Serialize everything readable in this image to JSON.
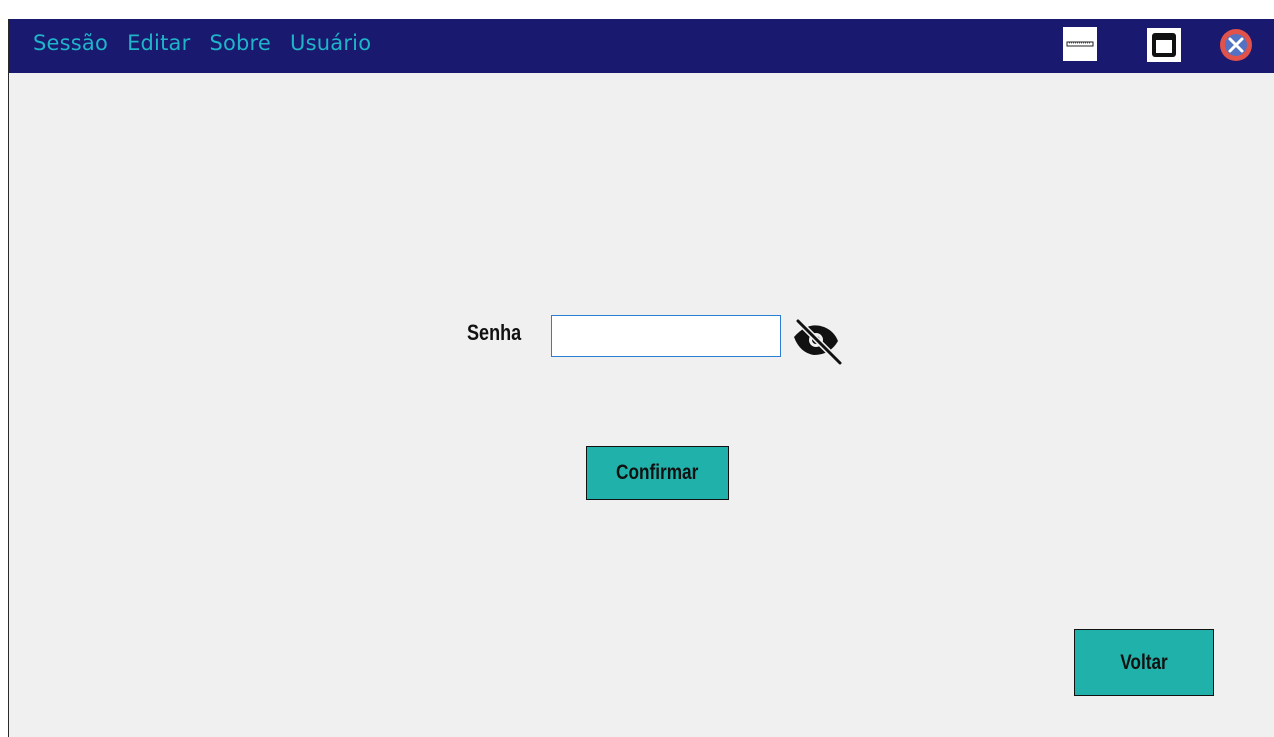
{
  "menu": {
    "items": [
      {
        "label": "Sessão"
      },
      {
        "label": "Editar"
      },
      {
        "label": "Sobre"
      },
      {
        "label": "Usuário"
      }
    ]
  },
  "window_controls": {
    "minimize_icon": "minimize-icon",
    "maximize_icon": "maximize-icon",
    "close_icon": "close-icon"
  },
  "form": {
    "senha_label": "Senha",
    "senha_value": "",
    "visibility_icon": "eye-slash-icon"
  },
  "buttons": {
    "confirmar_label": "Confirmar",
    "voltar_label": "Voltar"
  },
  "colors": {
    "titlebar": "#191970",
    "menu_text": "#1fb4c8",
    "button_fill": "#20b2aa",
    "background": "#f0f0f0",
    "close_button": "#e0524a"
  }
}
